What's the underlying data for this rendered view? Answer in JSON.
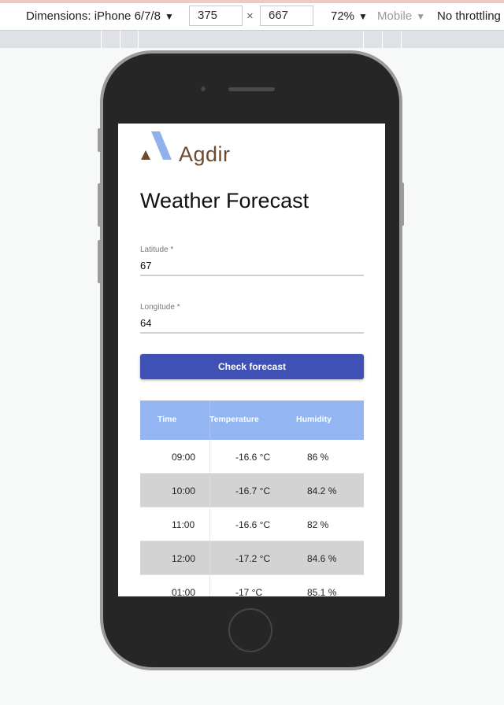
{
  "devtools": {
    "dimensions_label": "Dimensions: iPhone 6/7/8",
    "width": "375",
    "times": "×",
    "height": "667",
    "zoom": "72%",
    "device_mode": "Mobile",
    "throttling": "No throttling",
    "caret": "▼"
  },
  "app": {
    "brand": "Agdir",
    "title": "Weather Forecast",
    "latitude": {
      "label": "Latitude *",
      "value": "67"
    },
    "longitude": {
      "label": "Longitude *",
      "value": "64"
    },
    "check_button": "Check forecast",
    "table": {
      "headers": [
        "Time",
        "Temperature",
        "Humidity"
      ],
      "rows": [
        {
          "time": "09:00",
          "temperature": "-16.6 °C",
          "humidity": "86 %"
        },
        {
          "time": "10:00",
          "temperature": "-16.7 °C",
          "humidity": "84.2 %"
        },
        {
          "time": "11:00",
          "temperature": "-16.6 °C",
          "humidity": "82 %"
        },
        {
          "time": "12:00",
          "temperature": "-17.2 °C",
          "humidity": "84.6 %"
        },
        {
          "time": "01:00",
          "temperature": "-17 °C",
          "humidity": "85.1 %"
        }
      ]
    }
  },
  "colors": {
    "primary_button": "#3f51b5",
    "table_header": "#93b5f2",
    "row_alt": "#d3d3d3",
    "brand_brown": "#6b4a2f",
    "brand_blue": "#8fb2ec"
  }
}
